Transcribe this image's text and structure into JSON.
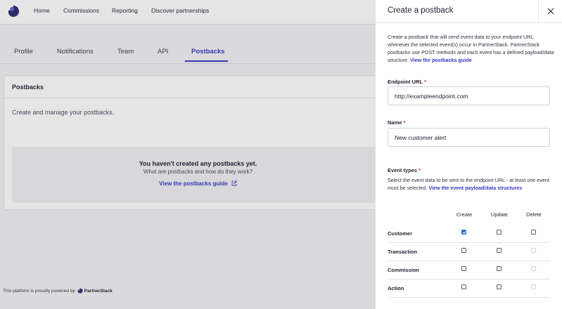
{
  "nav": {
    "items": [
      "Home",
      "Commissions",
      "Reporting",
      "Discover partnerships"
    ]
  },
  "tabs": [
    "Profile",
    "Notifications",
    "Team",
    "API",
    "Postbacks"
  ],
  "active_tab": "Postbacks",
  "card": {
    "title": "Postbacks",
    "description": "Create and manage your postbacks.",
    "empty_title": "You haven't created any postbacks yet.",
    "empty_subtitle": "What are postbacks and how do they work?",
    "empty_link": "View the postbacks guide"
  },
  "footer": {
    "powered_text": "This platform is proudly powered by",
    "brand": "PartnerStack"
  },
  "drawer": {
    "title": "Create a postback",
    "intro": "Create a postback that will send event data to your endpoint URL whenever the selected event(s) occur in PartnerStack. PartnerStack postbacks use POST methods and each event has a defined payload/data structure.",
    "intro_link": "View the postbacks guide",
    "endpoint_label": "Endpoint URL",
    "endpoint_value": "http://exampleendpoint.com",
    "name_label": "Name",
    "name_value": "New customer alert",
    "event_types_label": "Event types",
    "event_types_desc": "Select the event data to be sent to the endpoint URL - at least one event must be selected.",
    "event_types_link": "View the event payload/data structures",
    "columns": [
      "Create",
      "Update",
      "Delete"
    ],
    "rows": [
      {
        "label": "Customer",
        "create": true,
        "update": false,
        "delete": false,
        "delete_disabled": false
      },
      {
        "label": "Transaction",
        "create": false,
        "update": false,
        "delete": false,
        "delete_disabled": true
      },
      {
        "label": "Commission",
        "create": false,
        "update": false,
        "delete": false,
        "delete_disabled": true
      },
      {
        "label": "Action",
        "create": false,
        "update": false,
        "delete": false,
        "delete_disabled": true
      }
    ],
    "required_mark": "*"
  },
  "colors": {
    "accent": "#3b36c8",
    "checkbox_checked": "#2f6bd8",
    "required": "#d02e2e"
  }
}
